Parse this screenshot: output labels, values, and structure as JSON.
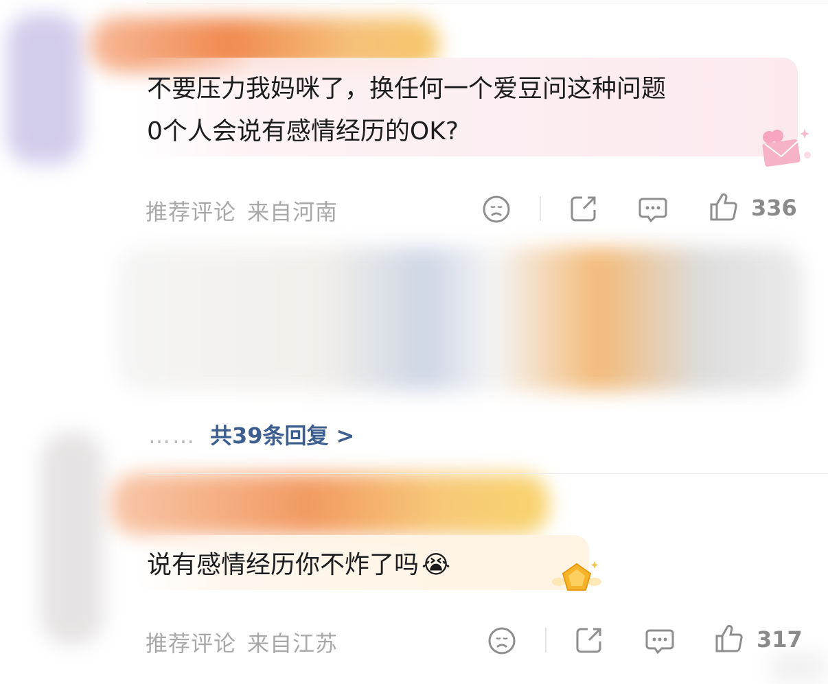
{
  "comments": [
    {
      "text_line1": "不要压力我妈咪了，换任何一个爱豆问这种问题",
      "text_line2": "0个人会说有感情经历的OK?",
      "tag": "推荐评论",
      "location": "来自河南",
      "likes": "336"
    },
    {
      "text": "说有感情经历你不炸了吗",
      "emoji": "😭",
      "tag": "推荐评论",
      "location": "来自江苏",
      "likes": "317"
    }
  ],
  "replies": {
    "dots": "……",
    "label": "共39条回复 >"
  }
}
